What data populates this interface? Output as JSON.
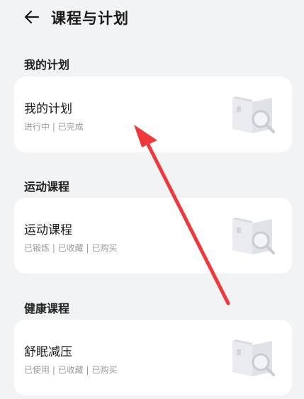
{
  "header": {
    "back_icon": "arrow-left-icon",
    "title": "课程与计划"
  },
  "sections": [
    {
      "title": "我的计划",
      "card": {
        "title": "我的计划",
        "subtitle": "进行中 | 已完成",
        "illustration": "book-search-icon"
      }
    },
    {
      "title": "运动课程",
      "card": {
        "title": "运动课程",
        "subtitle": "已锻炼 | 已收藏 | 已购买",
        "illustration": "book-search-icon"
      }
    },
    {
      "title": "健康课程",
      "card": {
        "title": "舒眠减压",
        "subtitle": "已使用 | 已收藏 | 已购买",
        "illustration": "book-search-icon"
      }
    }
  ],
  "annotation": {
    "arrow_color": "#f0383a"
  },
  "colors": {
    "background": "#f1f3f5",
    "card": "#ffffff",
    "subtitle": "#9a9a9a"
  }
}
